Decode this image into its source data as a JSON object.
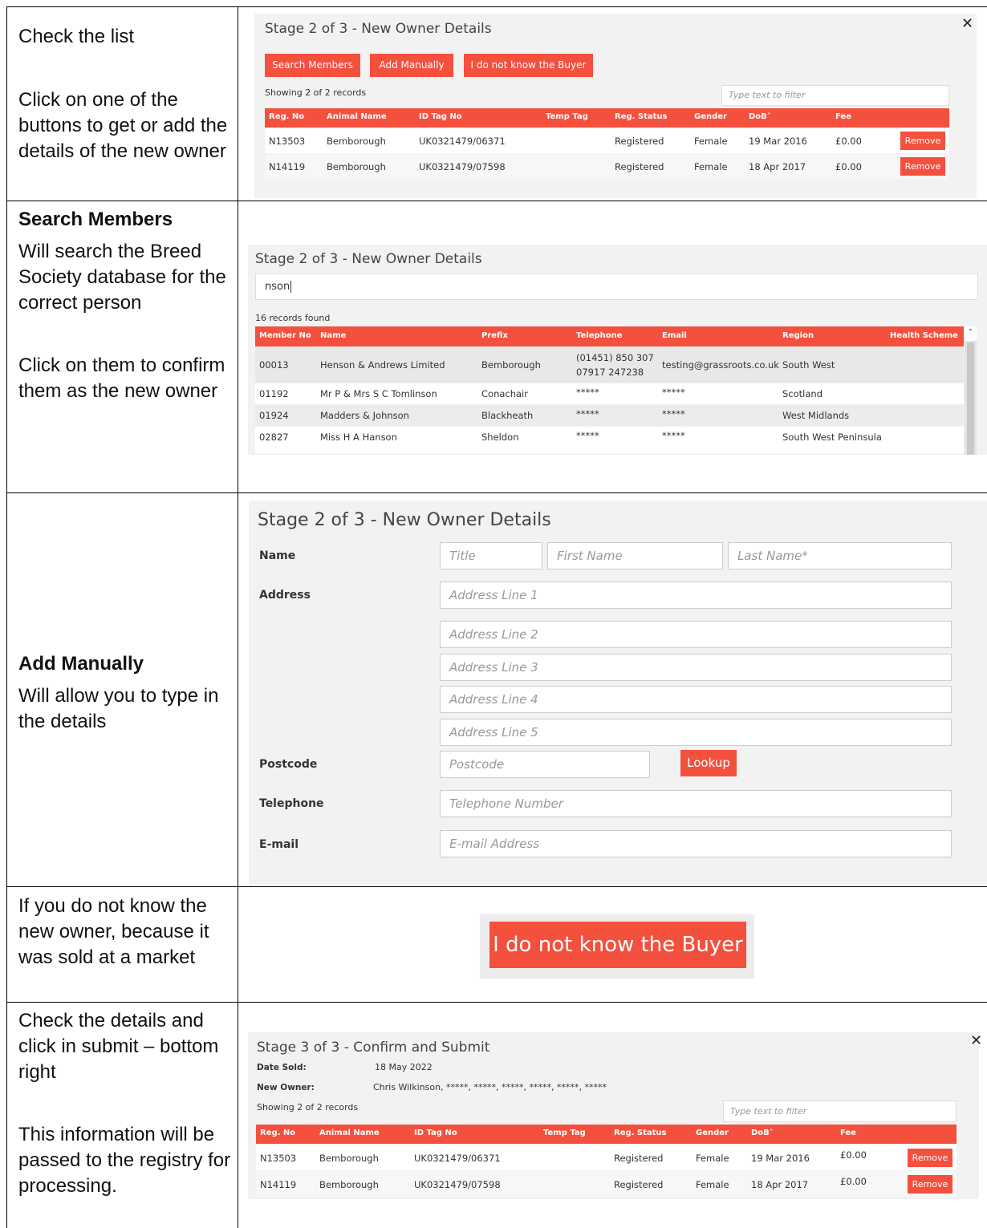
{
  "row1": {
    "left_text_1": "Check the list",
    "left_text_2": "Click on one of the buttons to get or add the details of the new owner",
    "panel": {
      "title": "Stage 2 of 3 - New Owner Details",
      "buttons": [
        "Search Members",
        "Add Manually",
        "I do not know the Buyer"
      ],
      "showing": "Showing 2 of 2 records",
      "filter_placeholder": "Type text to filter",
      "columns": [
        "Reg. No",
        "Animal Name",
        "ID Tag No",
        "Temp Tag",
        "Reg. Status",
        "Gender",
        "DoB˄",
        "Fee"
      ],
      "rows": [
        {
          "reg": "N13503",
          "animal": "Bemborough",
          "tag": "UK0321479/06371",
          "temp": "",
          "status": "Registered",
          "gender": "Female",
          "dob": "19 Mar 2016",
          "fee": "£0.00",
          "action": "Remove"
        },
        {
          "reg": "N14119",
          "animal": "Bemborough",
          "tag": "UK0321479/07598",
          "temp": "",
          "status": "Registered",
          "gender": "Female",
          "dob": "18 Apr 2017",
          "fee": "£0.00",
          "action": "Remove"
        }
      ]
    }
  },
  "row2": {
    "heading": "Search Members",
    "text_1": "Will search the Breed Society database for the correct person",
    "text_2": "Click on them to confirm them as the new owner",
    "panel": {
      "title": "Stage 2 of 3 - New Owner Details",
      "search_value": "nson",
      "found": "16 records found",
      "columns": [
        "Member No",
        "Name",
        "Prefix",
        "Telephone",
        "Email",
        "Region",
        "Health Scheme"
      ],
      "rows": [
        {
          "no": "00013",
          "name": "Henson & Andrews Limited",
          "prefix": "Bemborough",
          "tel1": "(01451) 850 307",
          "tel2": "07917 247238",
          "email": "testing@grassroots.co.uk",
          "region": "South West"
        },
        {
          "no": "01192",
          "name": "Mr P & Mrs S C Tomlinson",
          "prefix": "Conachair",
          "tel1": "*****",
          "tel2": "",
          "email": "*****",
          "region": "Scotland"
        },
        {
          "no": "01924",
          "name": "Madders & Johnson",
          "prefix": "Blackheath",
          "tel1": "*****",
          "tel2": "",
          "email": "*****",
          "region": "West Midlands"
        },
        {
          "no": "02827",
          "name": "Miss H A Hanson",
          "prefix": "Sheldon",
          "tel1": "*****",
          "tel2": "",
          "email": "*****",
          "region": "South West Peninsula"
        }
      ]
    }
  },
  "row3": {
    "heading": "Add Manually",
    "text": "Will allow you to type in the details",
    "panel": {
      "title": "Stage 2 of 3 - New Owner Details",
      "labels": {
        "name": "Name",
        "address": "Address",
        "postcode": "Postcode",
        "telephone": "Telephone",
        "email": "E-mail"
      },
      "placeholders": {
        "title": "Title",
        "first": "First Name",
        "last": "Last Name*",
        "addr1": "Address Line 1",
        "addr2": "Address Line 2",
        "addr3": "Address Line 3",
        "addr4": "Address Line 4",
        "addr5": "Address Line 5",
        "postcode": "Postcode",
        "telephone": "Telephone Number",
        "email": "E-mail Address"
      },
      "lookup": "Lookup"
    }
  },
  "row4": {
    "text": "If you do not know the new owner, because it was sold at a market",
    "button": "I do not know the Buyer"
  },
  "row5": {
    "text_1": "Check the details and click in submit – bottom right",
    "text_2": "This information will be passed to the registry for processing.",
    "panel": {
      "title": "Stage 3 of 3 - Confirm and Submit",
      "date_label": "Date Sold:",
      "date_value": "18 May 2022",
      "owner_label": "New Owner:",
      "owner_value": "Chris Wilkinson, *****, *****, *****, *****, *****, *****",
      "showing": "Showing 2 of 2 records",
      "filter_placeholder": "Type text to filter",
      "columns": [
        "Reg. No",
        "Animal Name",
        "ID Tag No",
        "Temp Tag",
        "Reg. Status",
        "Gender",
        "DoB˄",
        "Fee"
      ],
      "rows": [
        {
          "reg": "N13503",
          "animal": "Bemborough",
          "tag": "UK0321479/06371",
          "status": "Registered",
          "gender": "Female",
          "dob": "19 Mar 2016",
          "fee": "£0.00",
          "action": "Remove"
        },
        {
          "reg": "N14119",
          "animal": "Bemborough",
          "tag": "UK0321479/07598",
          "status": "Registered",
          "gender": "Female",
          "dob": "18 Apr 2017",
          "fee": "£0.00",
          "action": "Remove"
        }
      ]
    }
  },
  "icons": {
    "close": "close-icon",
    "sort": "sort-up-icon",
    "scroll": "scroll-up-icon"
  }
}
